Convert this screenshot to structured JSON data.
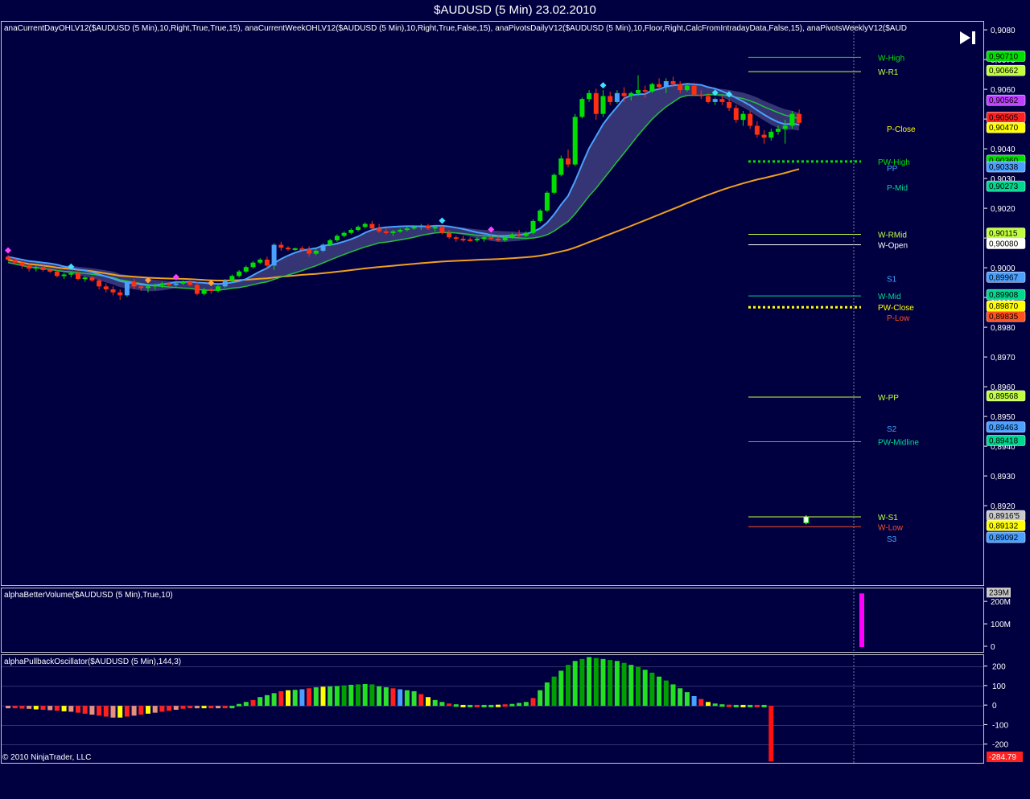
{
  "window": {
    "title": "$AUDUSD (5 Min)  23.02.2010"
  },
  "panels": {
    "price_indicators": "anaCurrentDayOHLV12($AUDUSD  (5 Min),10,Right,True,True,15),  anaCurrentWeekOHLV12($AUDUSD  (5 Min),10,Right,True,False,15),  anaPivotsDailyV12($AUDUSD  (5 Min),10,Floor,Right,CalcFromIntradayData,False,15),  anaPivotsWeeklyV12($AUD",
    "volume_indicator": "alphaBetterVolume($AUDUSD (5 Min),True,10)",
    "oscillator_indicator": "alphaPullbackOscillator($AUDUSD (5 Min),144,3)",
    "copyright": "© 2010 NinjaTrader, LLC"
  },
  "colors": {
    "background": "#000040",
    "bull": "#00e000",
    "bear": "#ff3010",
    "blue": "#4aa0ff",
    "violet": "#c040ff",
    "orange": "#f0a020",
    "yellow": "#ffff00"
  },
  "price_axis": {
    "range": [
      0.8893,
      0.9083
    ],
    "ticks": [
      "0,9080",
      "0,9070",
      "0,9060",
      "0,9050",
      "0,9040",
      "0,9030",
      "0,9020",
      "0,9010",
      "0,9000",
      "0,8990",
      "0,8980",
      "0,8970",
      "0,8960",
      "0,8950",
      "0,8940",
      "0,8930",
      "0,8920"
    ],
    "tick_values": [
      0.908,
      0.907,
      0.906,
      0.905,
      0.904,
      0.903,
      0.902,
      0.901,
      0.9,
      0.899,
      0.898,
      0.897,
      0.896,
      0.895,
      0.894,
      0.893,
      0.892
    ]
  },
  "price_badges": [
    {
      "text": "0,90710",
      "value": 0.9071,
      "color": "#00e000"
    },
    {
      "text": "0,90662",
      "value": 0.90662,
      "color": "#c0ff40"
    },
    {
      "text": "0,90562",
      "value": 0.90562,
      "color": "#c040ff"
    },
    {
      "text": "0,90505",
      "value": 0.90505,
      "color": "#ff2020"
    },
    {
      "text": "0,90470",
      "value": 0.9047,
      "color": "#ffff00"
    },
    {
      "text": "0,90360",
      "value": 0.9036,
      "color": "#00e000"
    },
    {
      "text": "0,90338",
      "value": 0.90338,
      "color": "#4aa0ff"
    },
    {
      "text": "0,90273",
      "value": 0.90273,
      "color": "#00d890"
    },
    {
      "text": "0,90115",
      "value": 0.90115,
      "color": "#c0ff40"
    },
    {
      "text": "0,90080",
      "value": 0.9008,
      "color": "#ffffff"
    },
    {
      "text": "0,89967",
      "value": 0.89967,
      "color": "#4aa0ff"
    },
    {
      "text": "0,89908",
      "value": 0.89908,
      "color": "#00d890"
    },
    {
      "text": "0,89870",
      "value": 0.8987,
      "color": "#ffff00"
    },
    {
      "text": "0,89835",
      "value": 0.89835,
      "color": "#ff5020"
    },
    {
      "text": "0,89568",
      "value": 0.89568,
      "color": "#c0ff40"
    },
    {
      "text": "0,89463",
      "value": 0.89463,
      "color": "#4aa0ff"
    },
    {
      "text": "0,89418",
      "value": 0.89418,
      "color": "#00d890"
    },
    {
      "text": "0,8916'5",
      "value": 0.89165,
      "color": "#c8c8c8"
    },
    {
      "text": "0,89132",
      "value": 0.89132,
      "color": "#ffff00"
    },
    {
      "text": "0,89092",
      "value": 0.89092,
      "color": "#4aa0ff"
    }
  ],
  "level_labels": [
    {
      "text": "W-High",
      "value": 0.9071,
      "color": "#00e000"
    },
    {
      "text": "W-R1",
      "value": 0.90662,
      "color": "#c0ff40"
    },
    {
      "text": "P-Close",
      "value": 0.9047,
      "color": "#ffff00"
    },
    {
      "text": "PW-High",
      "value": 0.9036,
      "color": "#00e000"
    },
    {
      "text": "PP",
      "value": 0.90338,
      "color": "#4aa0ff"
    },
    {
      "text": "P-Mid",
      "value": 0.90273,
      "color": "#00d890"
    },
    {
      "text": "W-RMid",
      "value": 0.90115,
      "color": "#c0ff40"
    },
    {
      "text": "W-Open",
      "value": 0.9008,
      "color": "#ffffff"
    },
    {
      "text": "S1",
      "value": 0.89967,
      "color": "#4aa0ff"
    },
    {
      "text": "W-Mid",
      "value": 0.89908,
      "color": "#00d890"
    },
    {
      "text": "PW-Close",
      "value": 0.8987,
      "color": "#ffff00"
    },
    {
      "text": "P-Low",
      "value": 0.89835,
      "color": "#ff5020"
    },
    {
      "text": "W-PP",
      "value": 0.89568,
      "color": "#c0ff40"
    },
    {
      "text": "S2",
      "value": 0.89463,
      "color": "#4aa0ff"
    },
    {
      "text": "PW-Midline",
      "value": 0.89418,
      "color": "#00d890"
    },
    {
      "text": "W-S1",
      "value": 0.89165,
      "color": "#c0ff40"
    },
    {
      "text": "W-Low",
      "value": 0.89132,
      "color": "#ff5020"
    },
    {
      "text": "S3",
      "value": 0.89092,
      "color": "#4aa0ff"
    }
  ],
  "volume_axis": {
    "range": [
      0,
      240
    ],
    "ticks": [
      "200M",
      "100M",
      "0"
    ],
    "tick_values": [
      200,
      100,
      0
    ],
    "badge": "239M",
    "last_value": 239
  },
  "osc_axis": {
    "range": [
      -300,
      260
    ],
    "ticks": [
      "200",
      "100",
      "0",
      "-100",
      "-200"
    ],
    "tick_values": [
      200,
      100,
      0,
      -100,
      -200
    ],
    "last_badge": "-284.79",
    "last_value": -284.79
  },
  "chart_data": {
    "type": "candlestick",
    "symbol": "$AUDUSD (5 Min)",
    "date": "23.02.2010",
    "candles": [
      [
        0.9004,
        0.90045,
        0.90025,
        0.9003
      ],
      [
        0.9003,
        0.90035,
        0.90015,
        0.9002
      ],
      [
        0.9002,
        0.90025,
        0.9,
        0.9001
      ],
      [
        0.9001,
        0.90015,
        0.8999,
        0.9
      ],
      [
        0.9,
        0.9001,
        0.8999,
        0.90005
      ],
      [
        0.90005,
        0.9001,
        0.8999,
        0.89995
      ],
      [
        0.89995,
        0.9,
        0.89985,
        0.8999
      ],
      [
        0.8999,
        0.89995,
        0.8997,
        0.89975
      ],
      [
        0.89975,
        0.89985,
        0.89965,
        0.8998
      ],
      [
        0.8998,
        0.8999,
        0.8997,
        0.89985
      ],
      [
        0.89985,
        0.8999,
        0.8996,
        0.89965
      ],
      [
        0.89965,
        0.89975,
        0.89955,
        0.8997
      ],
      [
        0.8997,
        0.89975,
        0.89955,
        0.8996
      ],
      [
        0.8996,
        0.89965,
        0.8993,
        0.8994
      ],
      [
        0.8994,
        0.8995,
        0.8992,
        0.8993
      ],
      [
        0.8993,
        0.8994,
        0.8991,
        0.8992
      ],
      [
        0.8992,
        0.8993,
        0.89895,
        0.8991
      ],
      [
        0.8991,
        0.8996,
        0.89905,
        0.89955
      ],
      [
        0.89955,
        0.89965,
        0.8993,
        0.8994
      ],
      [
        0.8994,
        0.89945,
        0.89925,
        0.89935
      ],
      [
        0.89935,
        0.89945,
        0.8992,
        0.8994
      ],
      [
        0.8994,
        0.8995,
        0.8993,
        0.89945
      ],
      [
        0.89945,
        0.89955,
        0.89935,
        0.8995
      ],
      [
        0.8995,
        0.89955,
        0.89935,
        0.89945
      ],
      [
        0.89945,
        0.89955,
        0.89935,
        0.8995
      ],
      [
        0.8995,
        0.8996,
        0.89945,
        0.89955
      ],
      [
        0.89955,
        0.8996,
        0.8994,
        0.89945
      ],
      [
        0.89945,
        0.89955,
        0.8991,
        0.89915
      ],
      [
        0.89915,
        0.89935,
        0.8991,
        0.8993
      ],
      [
        0.8993,
        0.89935,
        0.89915,
        0.89925
      ],
      [
        0.89925,
        0.89945,
        0.8992,
        0.8994
      ],
      [
        0.8994,
        0.89965,
        0.89935,
        0.8996
      ],
      [
        0.8996,
        0.8998,
        0.89955,
        0.89975
      ],
      [
        0.89975,
        0.89995,
        0.8997,
        0.8999
      ],
      [
        0.8999,
        0.9001,
        0.89985,
        0.90005
      ],
      [
        0.90005,
        0.90025,
        0.9,
        0.9002
      ],
      [
        0.9002,
        0.90035,
        0.90015,
        0.9003
      ],
      [
        0.9003,
        0.9004,
        0.9,
        0.9001
      ],
      [
        0.9001,
        0.90085,
        0.89995,
        0.9008
      ],
      [
        0.9008,
        0.9009,
        0.9006,
        0.9007
      ],
      [
        0.9007,
        0.90075,
        0.9006,
        0.90065
      ],
      [
        0.90065,
        0.9007,
        0.9006,
        0.90068
      ],
      [
        0.90068,
        0.90075,
        0.9006,
        0.90065
      ],
      [
        0.90065,
        0.90075,
        0.9004,
        0.9005
      ],
      [
        0.9005,
        0.90065,
        0.90045,
        0.9006
      ],
      [
        0.9006,
        0.90085,
        0.90055,
        0.9008
      ],
      [
        0.9008,
        0.901,
        0.90075,
        0.90095
      ],
      [
        0.90095,
        0.90115,
        0.9009,
        0.9011
      ],
      [
        0.9011,
        0.90125,
        0.90105,
        0.9012
      ],
      [
        0.9012,
        0.90135,
        0.90115,
        0.9013
      ],
      [
        0.9013,
        0.90145,
        0.90125,
        0.9014
      ],
      [
        0.9014,
        0.90155,
        0.90135,
        0.9015
      ],
      [
        0.9015,
        0.9016,
        0.9013,
        0.90135
      ],
      [
        0.90135,
        0.9015,
        0.9012,
        0.90125
      ],
      [
        0.90125,
        0.90135,
        0.90115,
        0.9012
      ],
      [
        0.9012,
        0.9013,
        0.9011,
        0.90125
      ],
      [
        0.90125,
        0.90135,
        0.9012,
        0.9013
      ],
      [
        0.9013,
        0.9014,
        0.90125,
        0.90135
      ],
      [
        0.90135,
        0.90145,
        0.9013,
        0.9014
      ],
      [
        0.9014,
        0.9015,
        0.9013,
        0.90145
      ],
      [
        0.90145,
        0.9015,
        0.9013,
        0.90135
      ],
      [
        0.90135,
        0.90145,
        0.90125,
        0.9014
      ],
      [
        0.9014,
        0.90145,
        0.90115,
        0.9012
      ],
      [
        0.9012,
        0.9013,
        0.901,
        0.90105
      ],
      [
        0.90105,
        0.9011,
        0.9009,
        0.901
      ],
      [
        0.901,
        0.9011,
        0.9009,
        0.90098
      ],
      [
        0.90098,
        0.90105,
        0.9009,
        0.90095
      ],
      [
        0.90095,
        0.90105,
        0.9009,
        0.901
      ],
      [
        0.901,
        0.9011,
        0.9009,
        0.90105
      ],
      [
        0.90105,
        0.90115,
        0.90095,
        0.901
      ],
      [
        0.901,
        0.9011,
        0.9009,
        0.90095
      ],
      [
        0.90095,
        0.9011,
        0.9009,
        0.90105
      ],
      [
        0.90105,
        0.9012,
        0.901,
        0.90115
      ],
      [
        0.90115,
        0.9013,
        0.90105,
        0.9011
      ],
      [
        0.9011,
        0.90125,
        0.90105,
        0.9012
      ],
      [
        0.9012,
        0.90165,
        0.90115,
        0.9016
      ],
      [
        0.9016,
        0.902,
        0.90155,
        0.90195
      ],
      [
        0.90195,
        0.9026,
        0.9019,
        0.90255
      ],
      [
        0.90255,
        0.9032,
        0.9025,
        0.90315
      ],
      [
        0.90315,
        0.9038,
        0.9031,
        0.9037
      ],
      [
        0.9037,
        0.904,
        0.9034,
        0.9035
      ],
      [
        0.9035,
        0.9052,
        0.90345,
        0.9051
      ],
      [
        0.9051,
        0.90575,
        0.90505,
        0.9057
      ],
      [
        0.9057,
        0.906,
        0.9056,
        0.9059
      ],
      [
        0.9059,
        0.90605,
        0.905,
        0.9052
      ],
      [
        0.9052,
        0.906,
        0.9051,
        0.9058
      ],
      [
        0.9058,
        0.90595,
        0.9055,
        0.9056
      ],
      [
        0.9056,
        0.906,
        0.90555,
        0.9059
      ],
      [
        0.9059,
        0.9061,
        0.9056,
        0.9058
      ],
      [
        0.9058,
        0.90595,
        0.90565,
        0.9059
      ],
      [
        0.9059,
        0.9065,
        0.9058,
        0.906
      ],
      [
        0.906,
        0.90615,
        0.90575,
        0.90595
      ],
      [
        0.90595,
        0.90625,
        0.9059,
        0.9062
      ],
      [
        0.9062,
        0.9064,
        0.906,
        0.9061
      ],
      [
        0.9061,
        0.9064,
        0.9059,
        0.9063
      ],
      [
        0.9063,
        0.90645,
        0.9061,
        0.9062
      ],
      [
        0.9062,
        0.9063,
        0.9059,
        0.906
      ],
      [
        0.906,
        0.9062,
        0.90595,
        0.90615
      ],
      [
        0.90615,
        0.90625,
        0.9058,
        0.90585
      ],
      [
        0.90585,
        0.906,
        0.9057,
        0.9058
      ],
      [
        0.9058,
        0.9059,
        0.90555,
        0.9056
      ],
      [
        0.9056,
        0.90575,
        0.9055,
        0.9057
      ],
      [
        0.9057,
        0.9058,
        0.9055,
        0.9056
      ],
      [
        0.9056,
        0.9057,
        0.9053,
        0.9054
      ],
      [
        0.9054,
        0.9055,
        0.9049,
        0.905
      ],
      [
        0.905,
        0.9053,
        0.9048,
        0.9052
      ],
      [
        0.9052,
        0.9053,
        0.9047,
        0.9048
      ],
      [
        0.9048,
        0.90495,
        0.9044,
        0.9045
      ],
      [
        0.9045,
        0.90465,
        0.9042,
        0.9044
      ],
      [
        0.9044,
        0.9047,
        0.9043,
        0.9046
      ],
      [
        0.9046,
        0.9048,
        0.9045,
        0.9047
      ],
      [
        0.9047,
        0.905,
        0.9042,
        0.9048
      ],
      [
        0.9048,
        0.9053,
        0.9047,
        0.9052
      ],
      [
        0.9052,
        0.90535,
        0.9048,
        0.9049
      ],
      [
        0.89145,
        0.8917,
        0.8914,
        0.89165
      ]
    ],
    "volume_last": 239,
    "oscillator": [
      -10,
      -12,
      -14,
      -15,
      -18,
      -20,
      -22,
      -25,
      -28,
      -30,
      -35,
      -40,
      -45,
      -50,
      -55,
      -60,
      -60,
      -55,
      -50,
      -45,
      -40,
      -35,
      -30,
      -25,
      -20,
      -15,
      -10,
      -8,
      -5,
      -5,
      -4,
      -3,
      0,
      10,
      20,
      30,
      45,
      55,
      65,
      75,
      80,
      82,
      85,
      90,
      95,
      98,
      100,
      102,
      105,
      108,
      110,
      112,
      110,
      100,
      95,
      90,
      85,
      80,
      75,
      60,
      45,
      30,
      20,
      12,
      8,
      5,
      5,
      5,
      5,
      5,
      6,
      8,
      10,
      15,
      20,
      40,
      80,
      120,
      150,
      180,
      210,
      230,
      240,
      250,
      245,
      240,
      235,
      230,
      220,
      210,
      200,
      185,
      170,
      150,
      130,
      110,
      90,
      70,
      50,
      35,
      20,
      12,
      8,
      6,
      5,
      5,
      5,
      5,
      5,
      -284.79
    ],
    "osc_colors": "green/red/yellow/blue/salmon alternating bars"
  }
}
